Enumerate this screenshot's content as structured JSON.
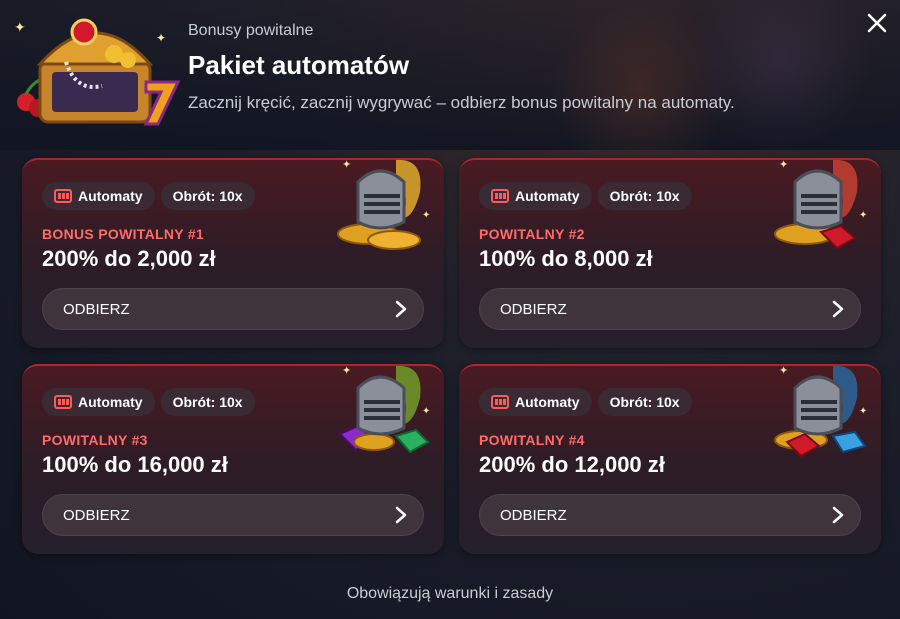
{
  "header": {
    "subtitle": "Bonusy powitalne",
    "title": "Pakiet automatów",
    "description": "Zacznij kręcić, zacznij wygrywać – odbierz bonus powitalny na automaty."
  },
  "cards": [
    {
      "category": "Automaty",
      "wager": "Obrót: 10x",
      "label": "BONUS POWITALNY #1",
      "amount": "200% do 2,000 zł",
      "button": "ODBIERZ",
      "plume_color": "#c8952a"
    },
    {
      "category": "Automaty",
      "wager": "Obrót: 10x",
      "label": "POWITALNY #2",
      "amount": "100% do 8,000 zł",
      "button": "ODBIERZ",
      "plume_color": "#b23a2e"
    },
    {
      "category": "Automaty",
      "wager": "Obrót: 10x",
      "label": "POWITALNY #3",
      "amount": "100% do 16,000 zł",
      "button": "ODBIERZ",
      "plume_color": "#6a8a2a"
    },
    {
      "category": "Automaty",
      "wager": "Obrót: 10x",
      "label": "POWITALNY #4",
      "amount": "200% do 12,000 zł",
      "button": "ODBIERZ",
      "plume_color": "#2e5a8a"
    }
  ],
  "footer": {
    "terms": "Obowiązują warunki i zasady"
  },
  "colors": {
    "accent_red": "#ff6b6b",
    "card_border": "#b0242e"
  },
  "icons": {
    "close": "close-icon",
    "chest": "treasure-chest-icon",
    "slot": "slot-machine-icon",
    "chevron": "chevron-right-icon",
    "knight": "knight-helmet-icon"
  }
}
